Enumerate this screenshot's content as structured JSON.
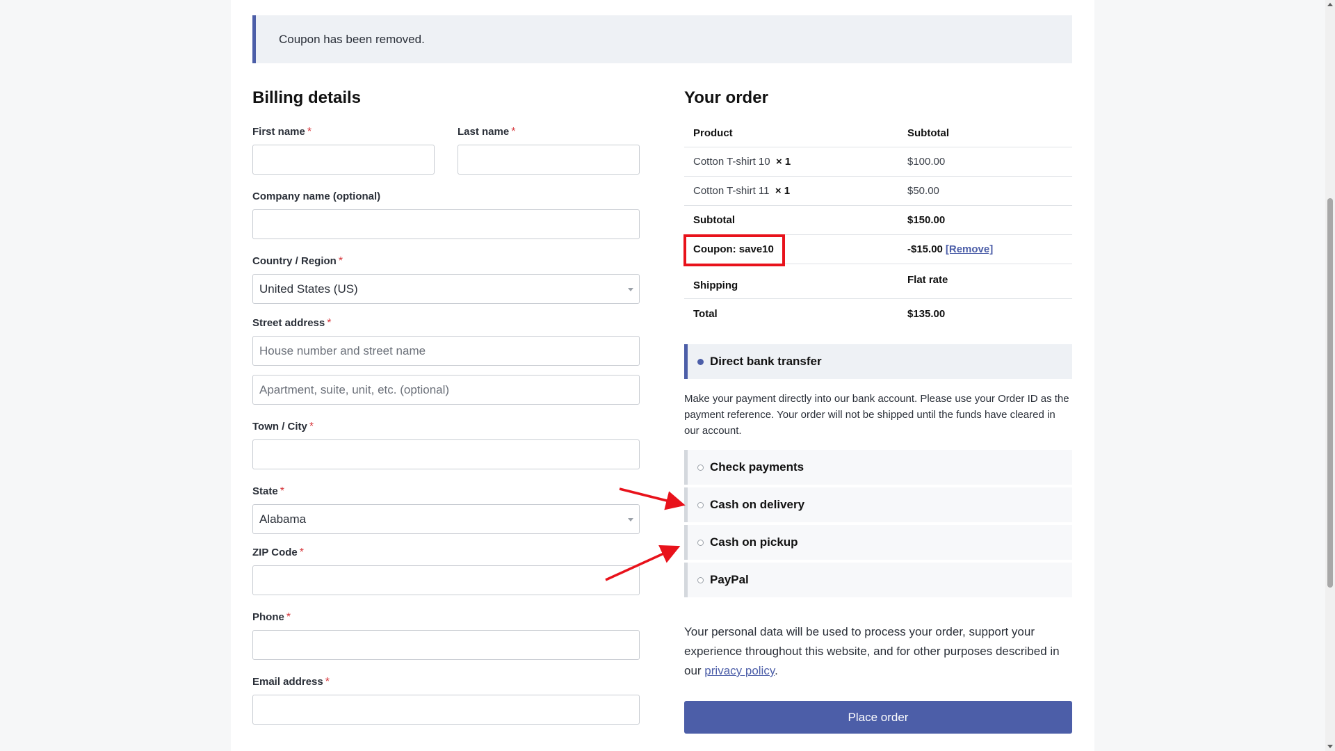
{
  "notice": {
    "text": "Coupon has been removed."
  },
  "billing": {
    "title": "Billing details",
    "required_mark": "*",
    "first_name": {
      "label": "First name",
      "value": ""
    },
    "last_name": {
      "label": "Last name",
      "value": ""
    },
    "company": {
      "label": "Company name (optional)",
      "value": ""
    },
    "country": {
      "label": "Country / Region",
      "value": "United States (US)"
    },
    "street": {
      "label": "Street address",
      "placeholder1": "House number and street name",
      "placeholder2": "Apartment, suite, unit, etc. (optional)"
    },
    "city": {
      "label": "Town / City",
      "value": ""
    },
    "state": {
      "label": "State",
      "value": "Alabama"
    },
    "zip": {
      "label": "ZIP Code",
      "value": ""
    },
    "phone": {
      "label": "Phone",
      "value": ""
    },
    "email": {
      "label": "Email address",
      "value": ""
    }
  },
  "order": {
    "title": "Your order",
    "header": {
      "product": "Product",
      "subtotal": "Subtotal"
    },
    "items": [
      {
        "name": "Cotton T-shirt 10",
        "qty": "× 1",
        "price": "$100.00"
      },
      {
        "name": "Cotton T-shirt 11",
        "qty": "× 1",
        "price": "$50.00"
      }
    ],
    "subtotal": {
      "label": "Subtotal",
      "value": "$150.00"
    },
    "coupon": {
      "label": "Coupon: save10",
      "value": "-$15.00",
      "remove": "[Remove]"
    },
    "shipping": {
      "label": "Shipping",
      "value": "Flat rate"
    },
    "total": {
      "label": "Total",
      "value": "$135.00"
    }
  },
  "payment": {
    "selected": "Direct bank transfer",
    "description": "Make your payment directly into our bank account. Please use your Order ID as the payment reference. Your order will not be shipped until the funds have cleared in our account.",
    "methods": [
      "Check payments",
      "Cash on delivery",
      "Cash on pickup",
      "PayPal"
    ]
  },
  "privacy": {
    "text_before": "Your personal data will be used to process your order, support your experience throughout this website, and for other purposes described in our ",
    "link": "privacy policy",
    "text_after": "."
  },
  "place_order": "Place order",
  "colors": {
    "accent": "#4c5ea8",
    "annotation": "#e8121b",
    "required": "#d6353a"
  }
}
